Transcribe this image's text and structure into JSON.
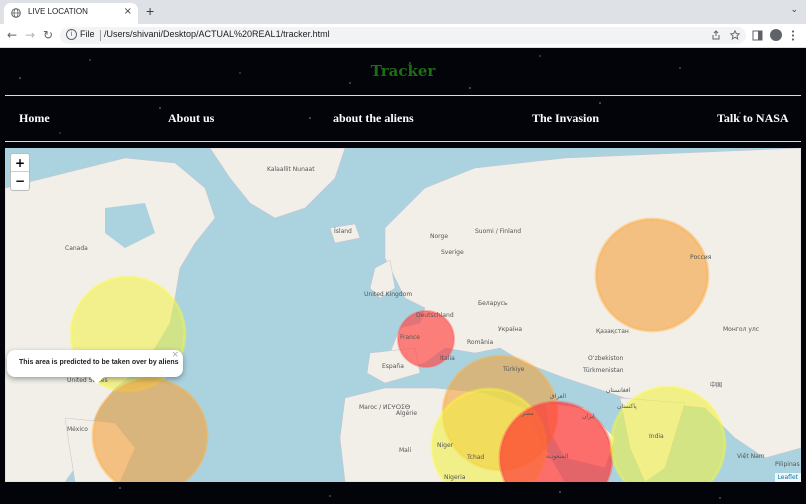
{
  "browser": {
    "tab_title": "LIVE LOCATION",
    "tab_close": "×",
    "new_tab": "+",
    "tab_menu": "⌄",
    "back": "←",
    "forward": "→",
    "reload": "↻",
    "info": "i",
    "file_label": "File",
    "url": "/Users/shivani/Desktop/ACTUAL%20REAL1/tracker.html"
  },
  "site": {
    "title": "Tracker",
    "title_color": "#1b6e12"
  },
  "nav": {
    "items": [
      "Home",
      "About us",
      "about the aliens",
      "The Invasion",
      "Talk to NASA"
    ]
  },
  "map": {
    "zoom_in": "+",
    "zoom_out": "−",
    "attribution": "Leaflet",
    "popup_text": "This area is predicted to be taken over by aliens",
    "popup_close": "×",
    "labels": [
      "Kalaallit Nunaat",
      "Canada",
      "Ísland",
      "Norge",
      "Suomi / Finland",
      "Sverige",
      "United Kingdom",
      "Deutschland",
      "France",
      "Беларусь",
      "Україна",
      "Россия",
      "Қазақстан",
      "Монгол улс",
      "România",
      "España",
      "Italia",
      "Türkiye",
      "Oʻzbekiston",
      "Türkmenistan",
      "افغانستان",
      "پاکستان",
      "中国",
      "India",
      "Việt Nam",
      "Pilipinas",
      "México",
      "United States",
      "Maroc / ⵍⵎⵖⵔⵉⴱ",
      "Algérie",
      "Mali",
      "Niger",
      "Tchad",
      "Nigeria",
      "مصر",
      "السعودية",
      "ایران",
      "العراق"
    ],
    "circles": [
      {
        "color": "#f5f55a",
        "label": "north-america-zone"
      },
      {
        "color": "#ffb347",
        "label": "caribbean-zone"
      },
      {
        "color": "#ff6b6b",
        "label": "france-zone"
      },
      {
        "color": "#ffb347",
        "label": "turkey-zone"
      },
      {
        "color": "#f5f55a",
        "label": "africa-zone"
      },
      {
        "color": "#ff4d4d",
        "label": "arabia-zone"
      },
      {
        "color": "#ffb347",
        "label": "russia-zone"
      },
      {
        "color": "#f5f55a",
        "label": "india-zone"
      }
    ]
  }
}
